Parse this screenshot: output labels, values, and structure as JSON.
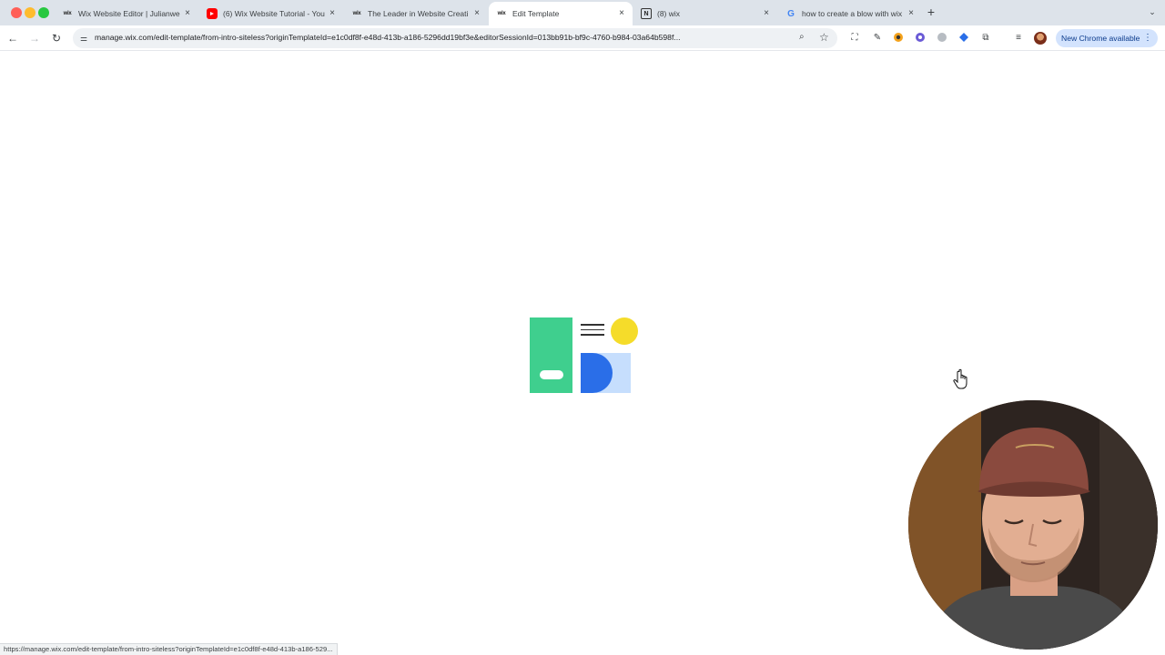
{
  "browser": {
    "tabs": [
      {
        "title": "Wix Website Editor | Julianwe",
        "favicon": "wix-icon",
        "active": false
      },
      {
        "title": "(6) Wix Website Tutorial - You",
        "favicon": "youtube-icon",
        "active": false
      },
      {
        "title": "The Leader in Website Creati",
        "favicon": "wix-icon",
        "active": false
      },
      {
        "title": "Edit Template",
        "favicon": "wix-icon",
        "active": true
      },
      {
        "title": "(8) wix",
        "favicon": "notion-icon",
        "active": false
      },
      {
        "title": "how to create a blow with wix",
        "favicon": "google-icon",
        "active": false
      }
    ],
    "new_tab_glyph": "+",
    "close_glyph": "×",
    "address_url": "manage.wix.com/edit-template/from-intro-siteless?originTemplateId=e1c0df8f-e48d-413b-a186-5296dd19bf3e&editorSessionId=013bb91b-bf9c-4760-b984-03a64b598f...",
    "update_chip_label": "New Chrome available",
    "status_url": "https://manage.wix.com/edit-template/from-intro-siteless?originTemplateId=e1c0df8f-e48d-413b-a186-529..."
  },
  "icons": {
    "back": "back-arrow-icon",
    "forward": "forward-arrow-icon",
    "reload": "reload-icon",
    "site_info": "tune-icon",
    "zoom": "zoom-icon",
    "bookmark": "star-icon",
    "screenshot": "screenshot-icon",
    "eyedropper": "eyedropper-icon",
    "extensions": "puzzle-icon",
    "media": "media-controls-icon",
    "menu": "kebab-menu-icon"
  },
  "colors": {
    "loader_green": "#3fcf8e",
    "loader_yellow": "#f5dc2a",
    "loader_blue": "#2a6ee8",
    "loader_light_blue": "#c6defd",
    "tabstrip_bg": "#dde3ea",
    "update_chip_bg": "#d3e3fd"
  }
}
